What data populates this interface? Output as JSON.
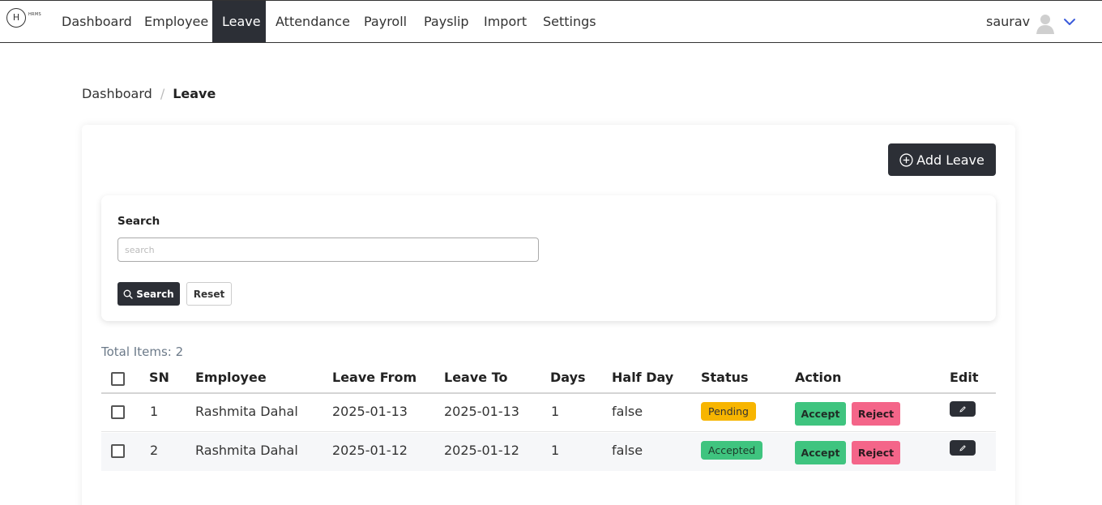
{
  "navbar": {
    "logo_letter": "H",
    "logo_sub": "HRMS",
    "items": [
      {
        "label": "Dashboard",
        "active": false
      },
      {
        "label": "Employee",
        "active": false
      },
      {
        "label": "Leave",
        "active": true
      },
      {
        "label": "Attendance",
        "active": false
      },
      {
        "label": "Payroll",
        "active": false
      },
      {
        "label": "Payslip",
        "active": false
      },
      {
        "label": "Import",
        "active": false
      },
      {
        "label": "Settings",
        "active": false
      }
    ],
    "user_name": "saurav"
  },
  "breadcrumb": {
    "parent": "Dashboard",
    "separator": "/",
    "current": "Leave"
  },
  "toolbar": {
    "add_leave_label": "Add Leave"
  },
  "search": {
    "label": "Search",
    "placeholder": "search",
    "value": "",
    "search_button": "Search",
    "reset_button": "Reset"
  },
  "table": {
    "total_items": "Total Items: 2",
    "columns": [
      "SN",
      "Employee",
      "Leave From",
      "Leave To",
      "Days",
      "Half Day",
      "Status",
      "Action",
      "Edit"
    ],
    "rows": [
      {
        "sn": "1",
        "employee": "Rashmita Dahal",
        "leave_from": "2025-01-13",
        "leave_to": "2025-01-13",
        "days": "1",
        "half_day": "false",
        "status": "Pending",
        "accept": "Accept",
        "reject": "Reject"
      },
      {
        "sn": "2",
        "employee": "Rashmita Dahal",
        "leave_from": "2025-01-12",
        "leave_to": "2025-01-12",
        "days": "1",
        "half_day": "false",
        "status": "Accepted",
        "accept": "Accept",
        "reject": "Reject"
      }
    ]
  },
  "colors": {
    "primary_dark": "#2c2f36",
    "pending": "#f7b500",
    "accepted": "#3fc47f",
    "reject": "#f46589"
  }
}
